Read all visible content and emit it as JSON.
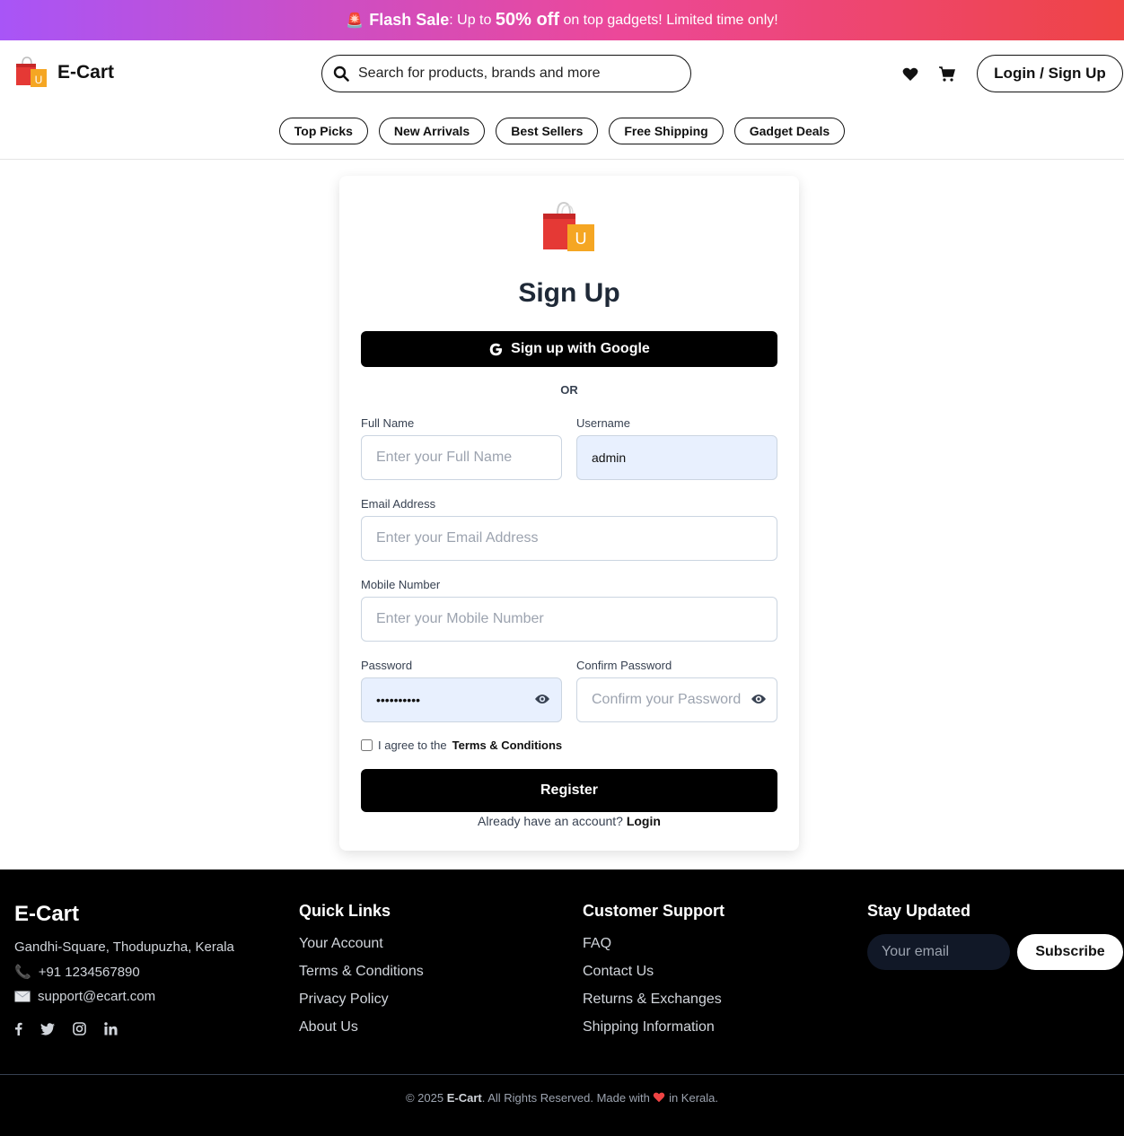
{
  "flash": {
    "label": "Flash Sale",
    "part1": ": Up to ",
    "percent": "50% off",
    "part2": " on top gadgets! Limited time only!"
  },
  "header": {
    "brand": "E-Cart",
    "search_placeholder": "Search for products, brands and more",
    "login_label": "Login / Sign Up"
  },
  "categories": [
    "Top Picks",
    "New Arrivals",
    "Best Sellers",
    "Free Shipping",
    "Gadget Deals"
  ],
  "signup": {
    "title": "Sign Up",
    "google_label": "Sign up with Google",
    "or_label": "OR",
    "full_name_label": "Full Name",
    "full_name_placeholder": "Enter your Full Name",
    "username_label": "Username",
    "username_value": "admin",
    "email_label": "Email Address",
    "email_placeholder": "Enter your Email Address",
    "mobile_label": "Mobile Number",
    "mobile_placeholder": "Enter your Mobile Number",
    "password_label": "Password",
    "password_value": "••••••••••",
    "confirm_label": "Confirm Password",
    "confirm_placeholder": "Confirm your Password",
    "agree_text": "I agree to the",
    "terms_label": "Terms & Conditions",
    "register_label": "Register",
    "already_text": "Already have an account?",
    "login_link": "Login"
  },
  "footer": {
    "brand": "E-Cart",
    "address": "Gandhi-Square, Thodupuzha, Kerala",
    "phone": "+91 1234567890",
    "email": "support@ecart.com",
    "quick_links_title": "Quick Links",
    "quick_links": [
      "Your Account",
      "Terms & Conditions",
      "Privacy Policy",
      "About Us"
    ],
    "support_title": "Customer Support",
    "support_links": [
      "FAQ",
      "Contact Us",
      "Returns & Exchanges",
      "Shipping Information"
    ],
    "stay_title": "Stay Updated",
    "email_placeholder": "Your email",
    "subscribe_label": "Subscribe",
    "copyright_pre": "© 2025 ",
    "copyright_brand": "E-Cart",
    "copyright_mid": ". All Rights Reserved. Made with ",
    "copyright_post": " in Kerala."
  },
  "colors": {
    "flash_gradient": [
      "#a855f7",
      "#ec4899",
      "#ef4444"
    ],
    "accent_black": "#000000",
    "autofill": "#e8f0fe",
    "heart_red": "#ef4444"
  },
  "icons": [
    "siren-icon",
    "shopping-bag-logo",
    "search-icon",
    "heart-icon",
    "cart-icon",
    "google-icon",
    "eye-icon",
    "phone-icon",
    "mail-icon",
    "facebook-icon",
    "twitter-icon",
    "instagram-icon",
    "linkedin-icon"
  ]
}
